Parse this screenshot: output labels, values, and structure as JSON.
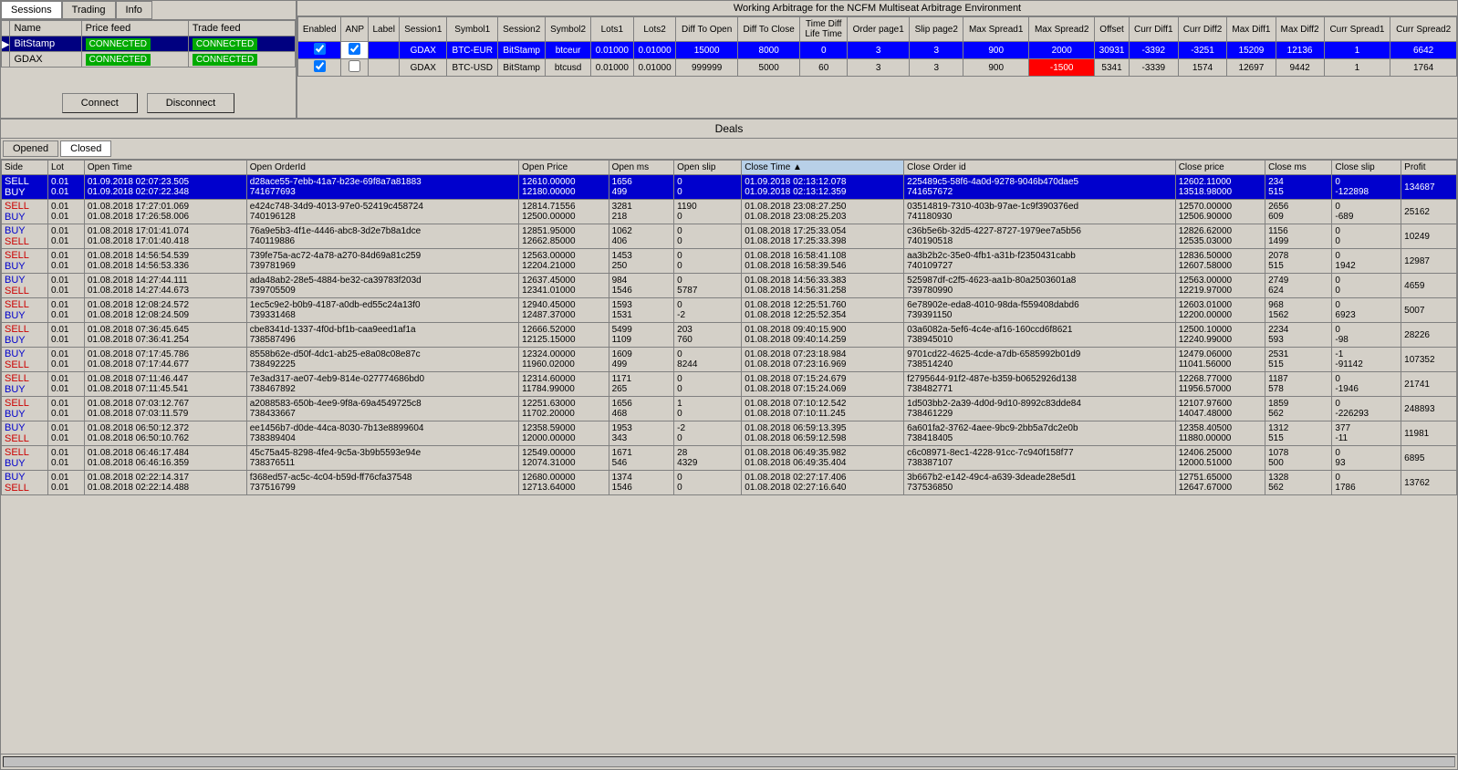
{
  "window": {
    "title": "Working Arbitrage for the NCFM Multiseat Arbitrage Environment"
  },
  "leftPanel": {
    "tabs": [
      "Sessions",
      "Trading",
      "Info"
    ],
    "activeTab": "Sessions",
    "tableHeaders": [
      "Name",
      "Price feed",
      "Trade feed"
    ],
    "rows": [
      {
        "selected": true,
        "name": "BitStamp",
        "priceFeed": "CONNECTED",
        "tradeFeed": "CONNECTED"
      },
      {
        "selected": false,
        "name": "GDAX",
        "priceFeed": "CONNECTED",
        "tradeFeed": "CONNECTED"
      }
    ]
  },
  "connectButtons": {
    "connect": "Connect",
    "disconnect": "Disconnect"
  },
  "arbTable": {
    "headers": [
      "Enabled",
      "ANP",
      "Label",
      "Session1",
      "Symbol1",
      "Session2",
      "Symbol2",
      "Lots1",
      "Lots2",
      "Diff To Open",
      "Diff To Close",
      "Time Diff Life Time",
      "Order page1",
      "Slip page2",
      "Max Spread1",
      "Max Spread2",
      "Offset",
      "Curr Diff1",
      "Curr Diff2",
      "Max Diff1",
      "Max Diff2",
      "Curr Spread1",
      "Curr Spread2"
    ],
    "rows": [
      {
        "blue": true,
        "enabled": true,
        "anp": true,
        "label": "",
        "session1": "GDAX",
        "symbol1": "BTC-EUR",
        "session2": "BitStamp",
        "symbol2": "btceur",
        "lots1": "0.01000",
        "lots2": "0.01000",
        "diffToOpen": "15000",
        "diffToClose": "8000",
        "lifeTime": "0",
        "orderPage1": "3",
        "slipPage2": "3",
        "maxSpread1": "900",
        "maxSpread2": "2000",
        "offset": "30931",
        "currDiff1": "-3392",
        "currDiff2": "-3251",
        "maxDiff1": "15209",
        "maxDiff2": "12136",
        "currSpread1": "1",
        "currSpread2": "6642",
        "redCell": false
      },
      {
        "blue": false,
        "enabled": true,
        "anp": false,
        "label": "",
        "session1": "GDAX",
        "symbol1": "BTC-USD",
        "session2": "BitStamp",
        "symbol2": "btcusd",
        "lots1": "0.01000",
        "lots2": "0.01000",
        "diffToOpen": "999999",
        "diffToClose": "5000",
        "lifeTime": "60",
        "orderPage1": "3",
        "slipPage2": "3",
        "maxSpread1": "900",
        "maxSpread2": "-1500",
        "offset": "5341",
        "currDiff1": "-3339",
        "currDiff2": "1574",
        "maxDiff1": "12697",
        "maxDiff2": "9442",
        "currSpread1": "1",
        "currSpread2": "1764",
        "redCell": true
      }
    ]
  },
  "deals": {
    "title": "Deals",
    "tabs": [
      "Opened",
      "Closed"
    ],
    "activeTab": "Closed",
    "tableHeaders": [
      "Side",
      "Lot",
      "Open Time",
      "Open OrderId",
      "Open Price",
      "Open ms",
      "Open slip",
      "Close Time",
      "Close Order id",
      "Close price",
      "Close ms",
      "Close slip",
      "Profit"
    ],
    "rows": [
      {
        "blue": true,
        "side1": "SELL",
        "side2": "BUY",
        "lot1": "0.01",
        "lot2": "0.01",
        "openTime1": "01.09.2018 02:07:23.505",
        "openTime2": "01.09.2018 02:07:22.348",
        "openOrderId1": "d28ace55-7ebb-41a7-b23e-69f8a7a81883",
        "openOrderId2": "741677693",
        "openPrice1": "12610.00000",
        "openPrice2": "12180.00000",
        "openMs1": "1656",
        "openMs2": "499",
        "openSlip1": "0",
        "openSlip2": "0",
        "closeTime1": "01.09.2018 02:13:12.078",
        "closeTime2": "01.09.2018 02:13:12.359",
        "closeOrderId1": "225489c5-58f6-4a0d-9278-9046b470dae5",
        "closeOrderId2": "741657672",
        "closePrice1": "12602.11000",
        "closePrice2": "13518.98000",
        "closeMs1": "234",
        "closeMs2": "515",
        "closeSlip1": "0",
        "closeSlip2": "-122898",
        "profit": "134687"
      },
      {
        "blue": false,
        "side1": "SELL",
        "side2": "BUY",
        "lot1": "0.01",
        "lot2": "0.01",
        "openTime1": "01.08.2018 17:27:01.069",
        "openTime2": "01.08.2018 17:26:58.006",
        "openOrderId1": "e424c748-34d9-4013-97e0-52419c458724",
        "openOrderId2": "740196128",
        "openPrice1": "12814.71556",
        "openPrice2": "12500.00000",
        "openMs1": "3281",
        "openMs2": "218",
        "openSlip1": "1190",
        "openSlip2": "0",
        "closeTime1": "01.08.2018 23:08:27.250",
        "closeTime2": "01.08.2018 23:08:25.203",
        "closeOrderId1": "03514819-7310-403b-97ae-1c9f390376ed",
        "closeOrderId2": "741180930",
        "closePrice1": "12570.00000",
        "closePrice2": "12506.90000",
        "closeMs1": "2656",
        "closeMs2": "609",
        "closeSlip1": "0",
        "closeSlip2": "-689",
        "profit": "25162"
      },
      {
        "blue": false,
        "side1": "BUY",
        "side2": "SELL",
        "lot1": "0.01",
        "lot2": "0.01",
        "openTime1": "01.08.2018 17:01:41.074",
        "openTime2": "01.08.2018 17:01:40.418",
        "openOrderId1": "76a9e5b3-4f1e-4446-abc8-3d2e7b8a1dce",
        "openOrderId2": "740119886",
        "openPrice1": "12851.95000",
        "openPrice2": "12662.85000",
        "openMs1": "1062",
        "openMs2": "406",
        "openSlip1": "0",
        "openSlip2": "0",
        "closeTime1": "01.08.2018 17:25:33.054",
        "closeTime2": "01.08.2018 17:25:33.398",
        "closeOrderId1": "c36b5e6b-32d5-4227-8727-1979ee7a5b56",
        "closeOrderId2": "740190518",
        "closePrice1": "12826.62000",
        "closePrice2": "12535.03000",
        "closeMs1": "1156",
        "closeMs2": "1499",
        "closeSlip1": "0",
        "closeSlip2": "0",
        "profit": "10249"
      },
      {
        "blue": false,
        "side1": "SELL",
        "side2": "BUY",
        "lot1": "0.01",
        "lot2": "0.01",
        "openTime1": "01.08.2018 14:56:54.539",
        "openTime2": "01.08.2018 14:56:53.336",
        "openOrderId1": "739fe75a-ac72-4a78-a270-84d69a81c259",
        "openOrderId2": "739781969",
        "openPrice1": "12563.00000",
        "openPrice2": "12204.21000",
        "openMs1": "1453",
        "openMs2": "250",
        "openSlip1": "0",
        "openSlip2": "0",
        "closeTime1": "01.08.2018 16:58:41.108",
        "closeTime2": "01.08.2018 16:58:39.546",
        "closeOrderId1": "aa3b2b2c-35e0-4fb1-a31b-f2350431cabb",
        "closeOrderId2": "740109727",
        "closePrice1": "12836.50000",
        "closePrice2": "12607.58000",
        "closeMs1": "2078",
        "closeMs2": "515",
        "closeSlip1": "0",
        "closeSlip2": "1942",
        "profit": "12987"
      },
      {
        "blue": false,
        "side1": "BUY",
        "side2": "SELL",
        "lot1": "0.01",
        "lot2": "0.01",
        "openTime1": "01.08.2018 14:27:44.111",
        "openTime2": "01.08.2018 14:27:44.673",
        "openOrderId1": "ada48ab2-28e5-4884-be32-ca39783f203d",
        "openOrderId2": "739705509",
        "openPrice1": "12637.45000",
        "openPrice2": "12341.01000",
        "openMs1": "984",
        "openMs2": "1546",
        "openSlip1": "0",
        "openSlip2": "5787",
        "closeTime1": "01.08.2018 14:56:33.383",
        "closeTime2": "01.08.2018 14:56:31.258",
        "closeOrderId1": "525987df-c2f5-4623-aa1b-80a2503601a8",
        "closeOrderId2": "739780990",
        "closePrice1": "12563.00000",
        "closePrice2": "12219.97000",
        "closeMs1": "2749",
        "closeMs2": "624",
        "closeSlip1": "0",
        "closeSlip2": "0",
        "profit": "4659"
      },
      {
        "blue": false,
        "side1": "SELL",
        "side2": "BUY",
        "lot1": "0.01",
        "lot2": "0.01",
        "openTime1": "01.08.2018 12:08:24.572",
        "openTime2": "01.08.2018 12:08:24.509",
        "openOrderId1": "1ec5c9e2-b0b9-4187-a0db-ed55c24a13f0",
        "openOrderId2": "739331468",
        "openPrice1": "12940.45000",
        "openPrice2": "12487.37000",
        "openMs1": "1593",
        "openMs2": "1531",
        "openSlip1": "0",
        "openSlip2": "-2",
        "closeTime1": "01.08.2018 12:25:51.760",
        "closeTime2": "01.08.2018 12:25:52.354",
        "closeOrderId1": "6e78902e-eda8-4010-98da-f559408dabd6",
        "closeOrderId2": "739391150",
        "closePrice1": "12603.01000",
        "closePrice2": "12200.00000",
        "closeMs1": "968",
        "closeMs2": "1562",
        "closeSlip1": "0",
        "closeSlip2": "6923",
        "profit": "5007"
      },
      {
        "blue": false,
        "side1": "SELL",
        "side2": "BUY",
        "lot1": "0.01",
        "lot2": "0.01",
        "openTime1": "01.08.2018 07:36:45.645",
        "openTime2": "01.08.2018 07:36:41.254",
        "openOrderId1": "cbe8341d-1337-4f0d-bf1b-caa9eed1af1a",
        "openOrderId2": "738587496",
        "openPrice1": "12666.52000",
        "openPrice2": "12125.15000",
        "openMs1": "5499",
        "openMs2": "1109",
        "openSlip1": "203",
        "openSlip2": "760",
        "closeTime1": "01.08.2018 09:40:15.900",
        "closeTime2": "01.08.2018 09:40:14.259",
        "closeOrderId1": "03a6082a-5ef6-4c4e-af16-160ccd6f8621",
        "closeOrderId2": "738945010",
        "closePrice1": "12500.10000",
        "closePrice2": "12240.99000",
        "closeMs1": "2234",
        "closeMs2": "593",
        "closeSlip1": "0",
        "closeSlip2": "-98",
        "profit": "28226"
      },
      {
        "blue": false,
        "side1": "BUY",
        "side2": "SELL",
        "lot1": "0.01",
        "lot2": "0.01",
        "openTime1": "01.08.2018 07:17:45.786",
        "openTime2": "01.08.2018 07:17:44.677",
        "openOrderId1": "8558b62e-d50f-4dc1-ab25-e8a08c08e87c",
        "openOrderId2": "738492225",
        "openPrice1": "12324.00000",
        "openPrice2": "11960.02000",
        "openMs1": "1609",
        "openMs2": "499",
        "openSlip1": "0",
        "openSlip2": "8244",
        "closeTime1": "01.08.2018 07:23:18.984",
        "closeTime2": "01.08.2018 07:23:16.969",
        "closeOrderId1": "9701cd22-4625-4cde-a7db-6585992b01d9",
        "closeOrderId2": "738514240",
        "closePrice1": "12479.06000",
        "closePrice2": "11041.56000",
        "closeMs1": "2531",
        "closeMs2": "515",
        "closeSlip1": "-1",
        "closeSlip2": "-91142",
        "profit": "107352"
      },
      {
        "blue": false,
        "side1": "SELL",
        "side2": "BUY",
        "lot1": "0.01",
        "lot2": "0.01",
        "openTime1": "01.08.2018 07:11:46.447",
        "openTime2": "01.08.2018 07:11:45.541",
        "openOrderId1": "7e3ad317-ae07-4eb9-814e-027774686bd0",
        "openOrderId2": "738467892",
        "openPrice1": "12314.60000",
        "openPrice2": "11784.99000",
        "openMs1": "1171",
        "openMs2": "265",
        "openSlip1": "0",
        "openSlip2": "0",
        "closeTime1": "01.08.2018 07:15:24.679",
        "closeTime2": "01.08.2018 07:15:24.069",
        "closeOrderId1": "f2795644-91f2-487e-b359-b0652926d138",
        "closeOrderId2": "738482771",
        "closePrice1": "12268.77000",
        "closePrice2": "11956.57000",
        "closeMs1": "1187",
        "closeMs2": "578",
        "closeSlip1": "0",
        "closeSlip2": "-1946",
        "profit": "21741"
      },
      {
        "blue": false,
        "side1": "SELL",
        "side2": "BUY",
        "lot1": "0.01",
        "lot2": "0.01",
        "openTime1": "01.08.2018 07:03:12.767",
        "openTime2": "01.08.2018 07:03:11.579",
        "openOrderId1": "a2088583-650b-4ee9-9f8a-69a4549725c8",
        "openOrderId2": "738433667",
        "openPrice1": "12251.63000",
        "openPrice2": "11702.20000",
        "openMs1": "1656",
        "openMs2": "468",
        "openSlip1": "1",
        "openSlip2": "0",
        "closeTime1": "01.08.2018 07:10:12.542",
        "closeTime2": "01.08.2018 07:10:11.245",
        "closeOrderId1": "1d503bb2-2a39-4d0d-9d10-8992c83dde84",
        "closeOrderId2": "738461229",
        "closePrice1": "12107.97600",
        "closePrice2": "14047.48000",
        "closeMs1": "1859",
        "closeMs2": "562",
        "closeSlip1": "0",
        "closeSlip2": "-226293",
        "profit": "248893"
      },
      {
        "blue": false,
        "side1": "BUY",
        "side2": "SELL",
        "lot1": "0.01",
        "lot2": "0.01",
        "openTime1": "01.08.2018 06:50:12.372",
        "openTime2": "01.08.2018 06:50:10.762",
        "openOrderId1": "ee1456b7-d0de-44ca-8030-7b13e8899604",
        "openOrderId2": "738389404",
        "openPrice1": "12358.59000",
        "openPrice2": "12000.00000",
        "openMs1": "1953",
        "openMs2": "343",
        "openSlip1": "-2",
        "openSlip2": "0",
        "closeTime1": "01.08.2018 06:59:13.395",
        "closeTime2": "01.08.2018 06:59:12.598",
        "closeOrderId1": "6a601fa2-3762-4aee-9bc9-2bb5a7dc2e0b",
        "closeOrderId2": "738418405",
        "closePrice1": "12358.40500",
        "closePrice2": "11880.00000",
        "closeMs1": "1312",
        "closeMs2": "515",
        "closeSlip1": "377",
        "closeSlip2": "-11",
        "profit": "11981"
      },
      {
        "blue": false,
        "side1": "SELL",
        "side2": "BUY",
        "lot1": "0.01",
        "lot2": "0.01",
        "openTime1": "01.08.2018 06:46:17.484",
        "openTime2": "01.08.2018 06:46:16.359",
        "openOrderId1": "45c75a45-8298-4fe4-9c5a-3b9b5593e94e",
        "openOrderId2": "738376511",
        "openPrice1": "12549.00000",
        "openPrice2": "12074.31000",
        "openMs1": "1671",
        "openMs2": "546",
        "openSlip1": "28",
        "openSlip2": "4329",
        "closeTime1": "01.08.2018 06:49:35.982",
        "closeTime2": "01.08.2018 06:49:35.404",
        "closeOrderId1": "c6c08971-8ec1-4228-91cc-7c940f158f77",
        "closeOrderId2": "738387107",
        "closePrice1": "12406.25000",
        "closePrice2": "12000.51000",
        "closeMs1": "1078",
        "closeMs2": "500",
        "closeSlip1": "0",
        "closeSlip2": "93",
        "profit": "6895"
      },
      {
        "blue": false,
        "side1": "BUY",
        "side2": "SELL",
        "lot1": "0.01",
        "lot2": "0.01",
        "openTime1": "01.08.2018 02:22:14.317",
        "openTime2": "01.08.2018 02:22:14.488",
        "openOrderId1": "f368ed57-ac5c-4c04-b59d-ff76cfa37548",
        "openOrderId2": "737516799",
        "openPrice1": "12680.00000",
        "openPrice2": "12713.64000",
        "openMs1": "1374",
        "openMs2": "1546",
        "openSlip1": "0",
        "openSlip2": "0",
        "closeTime1": "01.08.2018 02:27:17.406",
        "closeTime2": "01.08.2018 02:27:16.640",
        "closeOrderId1": "3b667b2-e142-49c4-a639-3deade28e5d1",
        "closeOrderId2": "737536850",
        "closePrice1": "12751.65000",
        "closePrice2": "12647.67000",
        "closeMs1": "1328",
        "closeMs2": "562",
        "closeSlip1": "0",
        "closeSlip2": "1786",
        "profit": "13762"
      }
    ]
  }
}
